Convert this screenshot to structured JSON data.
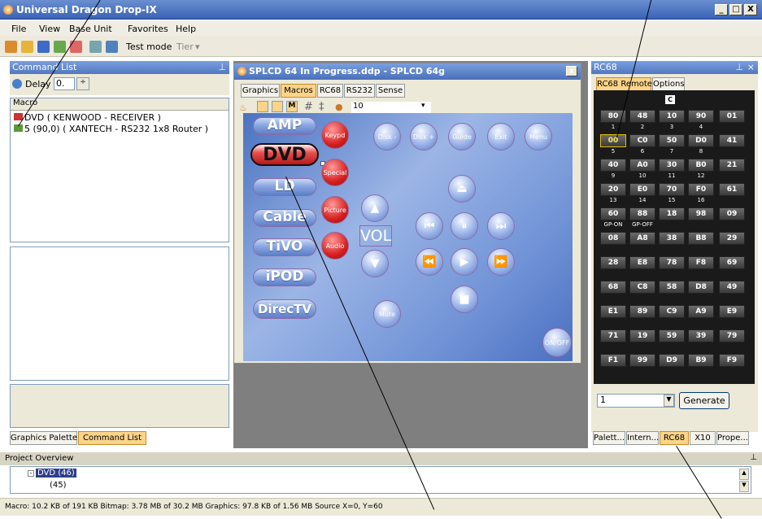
{
  "window": {
    "title": "Universal Dragon Drop-IX",
    "min": "_",
    "max": "□",
    "close": "X"
  },
  "menu": [
    "File",
    "View",
    "Base Unit",
    "Favorites",
    "Help"
  ],
  "toolbar": {
    "test_mode": "Test mode",
    "tier": "Tier"
  },
  "command_list": {
    "header": "Command List",
    "delay_label": "Delay",
    "delay_value": "0.",
    "column": "Macro",
    "items": [
      "DVD ( KENWOOD - RECEIVER )",
      "5 (90,0) ( XANTECH - RS232 1x8 Router )"
    ]
  },
  "left_tabs": [
    "Graphics Palette",
    "Command List"
  ],
  "doc": {
    "title": "SPLCD 64 In Progress.ddp - SPLCD 64g",
    "tabs": [
      "Graphics",
      "Macros",
      "RC68",
      "RS232",
      "Sense"
    ],
    "zoom": "10"
  },
  "canvas": {
    "sources": [
      "AMP",
      "DVD",
      "LD",
      "Cable",
      "TiVO",
      "iPOD",
      "DirecTV"
    ],
    "red_buttons": [
      "Keypd",
      "Special",
      "Picture",
      "Audio"
    ],
    "top_buttons": [
      "Disk -",
      "Disk +",
      "Guide",
      "Exit",
      "Menu"
    ],
    "vol": "VOL",
    "mute": "Mute",
    "power": "ON/OFF"
  },
  "rc68": {
    "header": "RC68",
    "tabs": [
      "RC68 Remote",
      "Options"
    ],
    "marker": "C",
    "rows": [
      {
        "keys": [
          "80",
          "48",
          "10",
          "90",
          "01"
        ],
        "labels": [
          "1",
          "2",
          "3",
          "4"
        ]
      },
      {
        "keys": [
          "00",
          "C0",
          "50",
          "D0",
          "41"
        ],
        "labels": [
          "5",
          "6",
          "7",
          "8"
        ]
      },
      {
        "keys": [
          "40",
          "A0",
          "30",
          "B0",
          "21"
        ],
        "labels": [
          "9",
          "10",
          "11",
          "12"
        ]
      },
      {
        "keys": [
          "20",
          "E0",
          "70",
          "F0",
          "61"
        ],
        "labels": [
          "13",
          "14",
          "15",
          "16"
        ]
      },
      {
        "keys": [
          "60",
          "88",
          "18",
          "98",
          "09"
        ],
        "labels": [
          "GP-ON",
          "GP-OFF"
        ]
      },
      {
        "keys": [
          "08",
          "A8",
          "38",
          "B8",
          "29"
        ],
        "labels": []
      },
      {
        "keys": [
          "28",
          "E8",
          "78",
          "F8",
          "69"
        ],
        "labels": []
      },
      {
        "keys": [
          "68",
          "C8",
          "58",
          "D8",
          "49"
        ],
        "labels": []
      },
      {
        "keys": [
          "E1",
          "89",
          "C9",
          "A9",
          "E9"
        ],
        "labels": []
      },
      {
        "keys": [
          "71",
          "19",
          "59",
          "39",
          "79"
        ],
        "labels": []
      },
      {
        "keys": [
          "F1",
          "99",
          "D9",
          "B9",
          "F9"
        ],
        "labels": []
      }
    ],
    "select_value": "1",
    "generate": "Generate"
  },
  "right_tabs": [
    "Palett...",
    "Intern...",
    "RC68",
    "X10",
    "Prope..."
  ],
  "project": {
    "header": "Project Overview",
    "node": "DVD (46)",
    "child": "(45)"
  },
  "status": "Macro: 10.2 KB of 191 KB  Bitmap: 3.78 MB of 30.2 MB  Graphics: 97.8 KB of 1.56 MB  Source  X=0, Y=60",
  "colors": {
    "title": "#3a63b5",
    "accent_tab": "#fbd48a",
    "keypad": "#1a1a1a"
  }
}
